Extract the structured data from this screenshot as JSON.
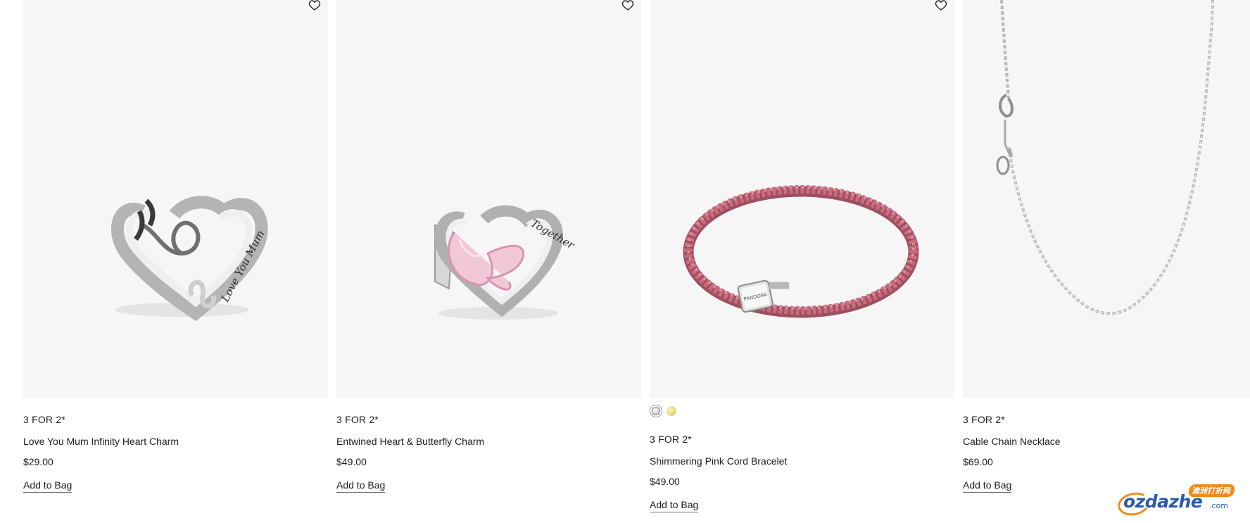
{
  "products": [
    {
      "promo": "3 FOR 2*",
      "name": "Love You Mum Infinity Heart Charm",
      "price": "$29.00",
      "add_label": "Add to Bag"
    },
    {
      "promo": "3 FOR 2*",
      "name": "Entwined Heart & Butterfly Charm",
      "price": "$49.00",
      "add_label": "Add to Bag"
    },
    {
      "promo": "3 FOR 2*",
      "name": "Shimmering Pink Cord Bracelet",
      "price": "$49.00",
      "add_label": "Add to Bag",
      "swatches": [
        "silver",
        "gold"
      ]
    },
    {
      "promo": "3 FOR 2*",
      "name": "Cable Chain Necklace",
      "price": "$69.00",
      "add_label": "Add to Bag"
    }
  ],
  "engraving": {
    "charm1": "Love You Mum",
    "charm2": "Together"
  },
  "watermark": {
    "text": "ozdazhe",
    "domain": ".com",
    "cn": "澳洲打折网"
  },
  "colors": {
    "image_bg": "#f6f6f6",
    "text": "#1c1c1c",
    "swatch_silver": "#d0d0d0",
    "swatch_gold": "#e3d27a",
    "cord_pink": "#c96b7e",
    "watermark_orange": "#f28a1b",
    "watermark_blue": "#2b5aa8"
  }
}
